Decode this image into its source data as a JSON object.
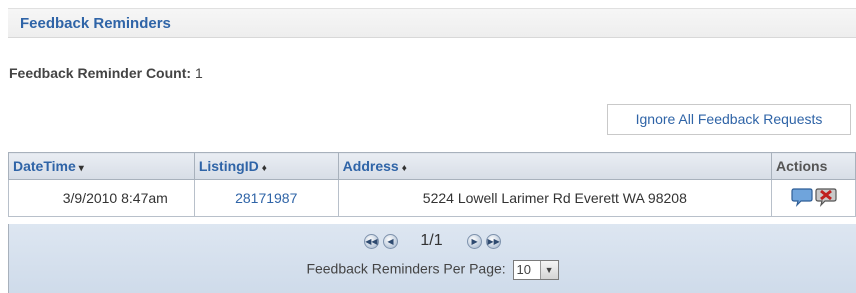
{
  "header": {
    "title": "Feedback Reminders"
  },
  "count": {
    "label": "Feedback Reminder Count:",
    "value": "1"
  },
  "ignore_button": {
    "label": "Ignore All Feedback Requests"
  },
  "table": {
    "columns": [
      {
        "label": "DateTime",
        "sort": "▾"
      },
      {
        "label": "ListingID",
        "sort": "♦"
      },
      {
        "label": "Address",
        "sort": "♦"
      },
      {
        "label": "Actions"
      }
    ],
    "rows": [
      {
        "datetime": "3/9/2010 8:47am",
        "listing_id": "28171987",
        "address": "5224 Lowell Larimer Rd Everett WA 98208"
      }
    ]
  },
  "pager": {
    "page_text": "1/1",
    "first_icon": "◀◀",
    "prev_icon": "◀",
    "next_icon": "▶",
    "last_icon": "▶▶",
    "per_page_label": "Feedback Reminders Per Page:",
    "per_page_value": "10",
    "dropdown_icon": "▼"
  }
}
